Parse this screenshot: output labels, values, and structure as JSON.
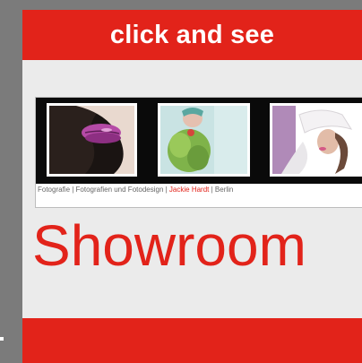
{
  "header": {
    "text": "click and see"
  },
  "gallery": {
    "thumbnails": [
      {
        "name": "lips-photo",
        "alt": "purple lips"
      },
      {
        "name": "green-feather-photo",
        "alt": "model with green feathers"
      },
      {
        "name": "white-hat-photo",
        "alt": "model with white hat"
      }
    ],
    "caption": {
      "part1": "Fotografie | Fotografien und Fotodesign |",
      "accent": "Jackie Hardt",
      "part2": "| Berlin"
    }
  },
  "showroom": {
    "title": "Showroom"
  },
  "colors": {
    "accent": "#e2231a",
    "background": "#ebebeb",
    "frame": "#7b7b7b"
  }
}
